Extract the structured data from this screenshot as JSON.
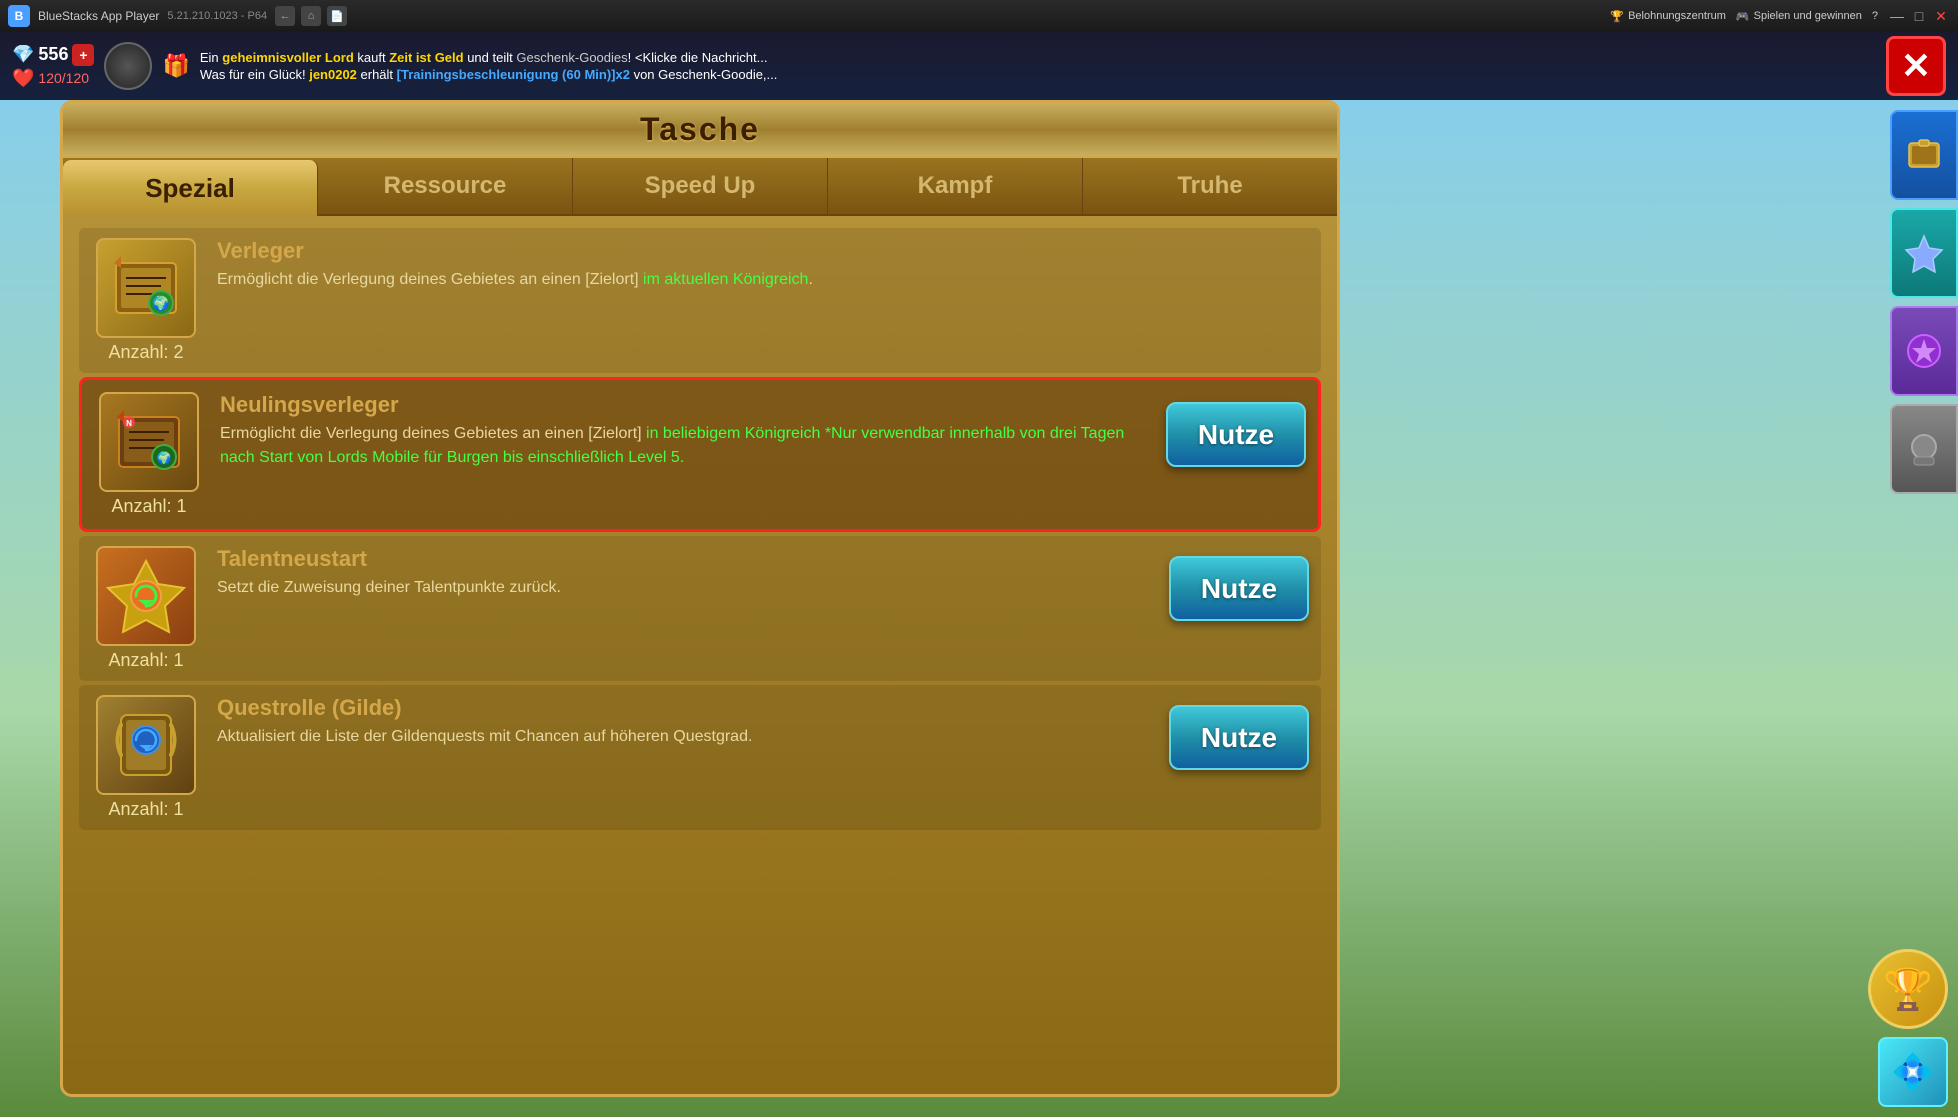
{
  "titlebar": {
    "app_name": "BlueStacks App Player",
    "version": "5.21.210.1023 - P64",
    "nav_back": "←",
    "nav_home": "⌂",
    "nav_bookmark": "📄",
    "menu_reward": "Belohnungszentrum",
    "menu_play": "Spielen und gewinnen",
    "menu_help": "?",
    "ctrl_minimize": "—",
    "ctrl_maximize": "□",
    "ctrl_close": "✕"
  },
  "notif": {
    "hp_count": "556",
    "hp_max": "120/120",
    "hp_add": "+",
    "line1_pre": "Ein ",
    "line1_lord": "geheimnisvoller Lord",
    "line1_mid1": " kauft ",
    "line1_item": "Zeit ist Geld",
    "line1_mid2": " und teilt ",
    "line1_gift": "Geschenk-Goodies",
    "line1_suffix": "! <Klicke die Nachricht...",
    "line2_pre": "Was für ein Glück! ",
    "line2_user": "jen0202",
    "line2_mid": " erhält ",
    "line2_reward": "[Trainingsbeschleunigung (60 Min)]x2",
    "line2_suffix": " von Geschenk-Goodie,...",
    "close_label": "✕"
  },
  "panel": {
    "title": "Tasche",
    "tabs": [
      {
        "id": "spezial",
        "label": "Spezial",
        "active": true
      },
      {
        "id": "ressource",
        "label": "Ressource",
        "active": false
      },
      {
        "id": "speedup",
        "label": "Speed Up",
        "active": false
      },
      {
        "id": "kampf",
        "label": "Kampf",
        "active": false
      },
      {
        "id": "truhe",
        "label": "Truhe",
        "active": false
      }
    ],
    "items": [
      {
        "id": "verleger",
        "name": "Verleger",
        "count": "Anzahl: 2",
        "desc_pre": "Ermöglicht die Verlegung deines Gebietes an einen [Zielort] ",
        "desc_green": "im aktuellen Königreich",
        "desc_post": ".",
        "highlighted": false,
        "has_button": false,
        "icon_emoji": "📜"
      },
      {
        "id": "neulingsverleger",
        "name": "Neulingsverleger",
        "count": "Anzahl: 1",
        "desc_pre": "Ermöglicht die Verlegung deines Gebietes an einen [Zielort] ",
        "desc_green1": "in beliebigem Königreich",
        "desc_green2": "*Nur verwendbar innerhalb von drei Tagen nach Start von Lords Mobile für Burgen bis einschließlich Level 5.",
        "desc_post": "",
        "highlighted": true,
        "has_button": true,
        "button_label": "Nutze",
        "icon_emoji": "📜"
      },
      {
        "id": "talentneustart",
        "name": "Talentneustart",
        "count": "Anzahl: 1",
        "desc_pre": "Setzt die Zuweisung deiner Talentpunkte zurück.",
        "desc_green": "",
        "desc_post": "",
        "highlighted": false,
        "has_button": true,
        "button_label": "Nutze",
        "icon_emoji": "👑"
      },
      {
        "id": "questrolle",
        "name": "Questrolle (Gilde)",
        "count": "Anzahl: 1",
        "desc_pre": "Aktualisiert die Liste der Gildenquests mit Chancen auf höheren Questgrad.",
        "desc_green": "",
        "desc_post": "",
        "highlighted": false,
        "has_button": true,
        "button_label": "Nutze",
        "icon_emoji": "🛡️"
      }
    ]
  },
  "sidebar": {
    "items": [
      {
        "id": "blue1",
        "icon": "🎒",
        "color": "blue"
      },
      {
        "id": "teal1",
        "icon": "💎",
        "color": "teal"
      },
      {
        "id": "purple1",
        "icon": "🔮",
        "color": "purple"
      },
      {
        "id": "gray1",
        "icon": "🏅",
        "color": "gray"
      }
    ]
  }
}
